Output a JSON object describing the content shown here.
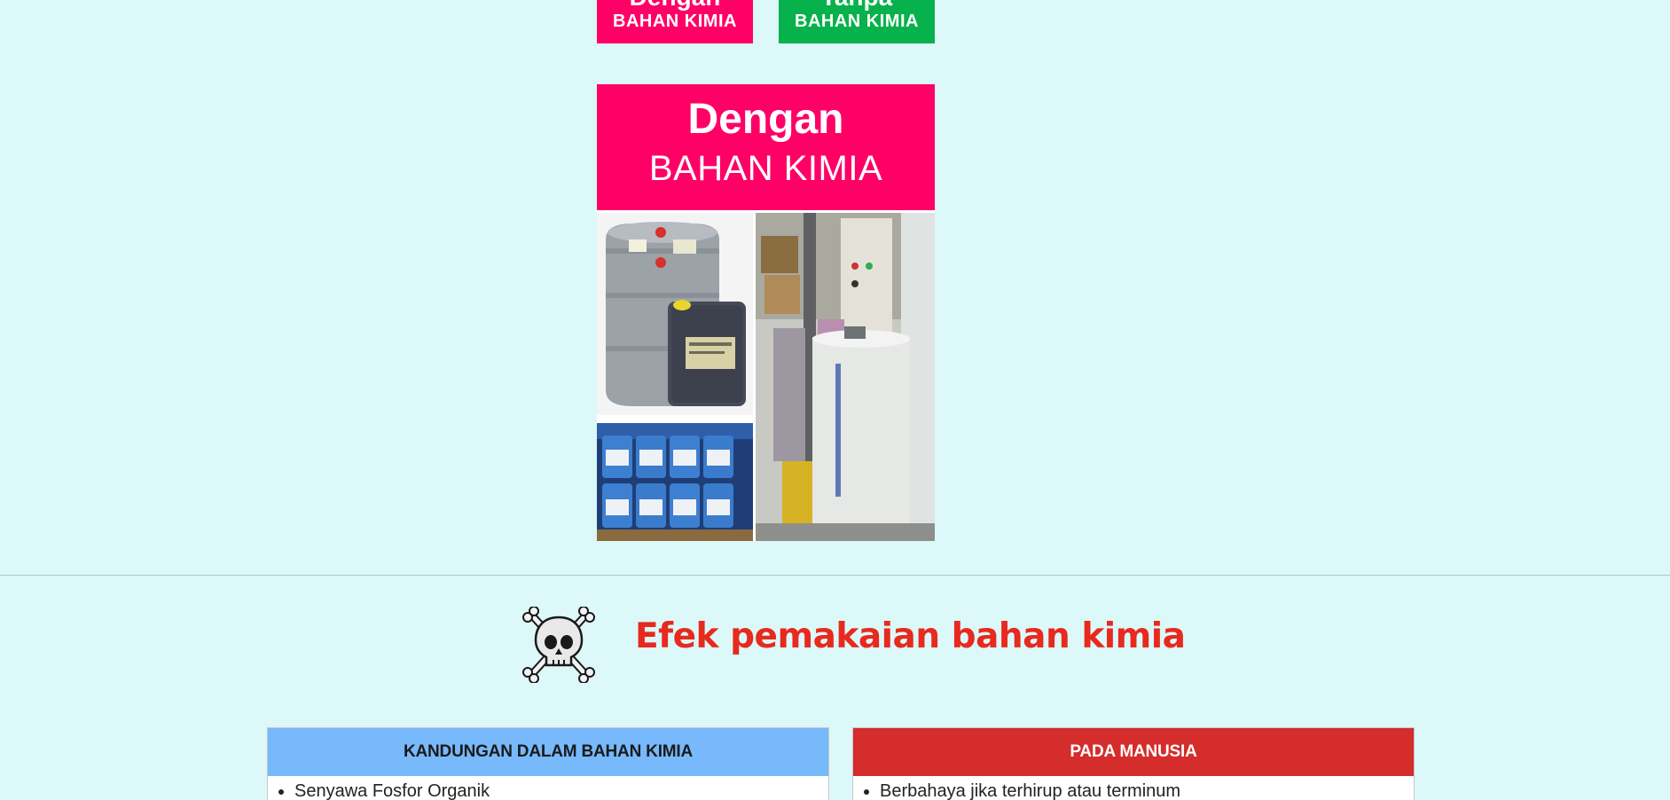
{
  "top_buttons": {
    "dengan": {
      "line1": "Dengan",
      "line2": "BAHAN KIMIA",
      "color": "#ff0066"
    },
    "tanpa": {
      "line1": "Tanpa",
      "line2": "BAHAN KIMIA",
      "color": "#07b14b"
    }
  },
  "feature": {
    "line1": "Dengan",
    "line2": "BAHAN KIMIA"
  },
  "section": {
    "icon": "skull-crossbones-icon",
    "title": "Efek pemakaian bahan kimia",
    "title_color": "#e8291e"
  },
  "cards": {
    "left": {
      "title": "KANDUNGAN DALAM BAHAN KIMIA",
      "header_color": "#78b9fb",
      "items": [
        "Senyawa Fosfor Organik"
      ]
    },
    "right": {
      "title": "PADA MANUSIA",
      "header_color": "#d52c2c",
      "items": [
        "Berbahaya jika terhirup atau terminum"
      ]
    }
  }
}
